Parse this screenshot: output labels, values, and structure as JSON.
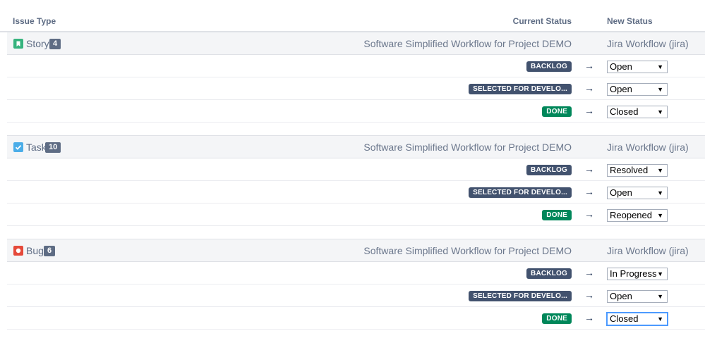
{
  "header": {
    "issue_type": "Issue Type",
    "current_status": "Current Status",
    "new_status": "New Status"
  },
  "groups": [
    {
      "type": "Story",
      "icon": "story-icon",
      "icon_color": "#36b37e",
      "count": "4",
      "current_workflow": "Software Simplified Workflow for Project DEMO",
      "new_workflow": "Jira Workflow (jira)",
      "rows": [
        {
          "status": "BACKLOG",
          "status_color": "#42526e",
          "new_status": "Open"
        },
        {
          "status": "SELECTED FOR DEVELO...",
          "status_color": "#42526e",
          "new_status": "Open"
        },
        {
          "status": "DONE",
          "status_color": "#00875a",
          "new_status": "Closed"
        }
      ]
    },
    {
      "type": "Task",
      "icon": "task-icon",
      "icon_color": "#4bade8",
      "count": "10",
      "current_workflow": "Software Simplified Workflow for Project DEMO",
      "new_workflow": "Jira Workflow (jira)",
      "rows": [
        {
          "status": "BACKLOG",
          "status_color": "#42526e",
          "new_status": "Resolved"
        },
        {
          "status": "SELECTED FOR DEVELO...",
          "status_color": "#42526e",
          "new_status": "Open"
        },
        {
          "status": "DONE",
          "status_color": "#00875a",
          "new_status": "Reopened"
        }
      ]
    },
    {
      "type": "Bug",
      "icon": "bug-icon",
      "icon_color": "#e5493a",
      "count": "6",
      "current_workflow": "Software Simplified Workflow for Project DEMO",
      "new_workflow": "Jira Workflow (jira)",
      "rows": [
        {
          "status": "BACKLOG",
          "status_color": "#42526e",
          "new_status": "In Progress"
        },
        {
          "status": "SELECTED FOR DEVELO...",
          "status_color": "#42526e",
          "new_status": "Open"
        },
        {
          "status": "DONE",
          "status_color": "#00875a",
          "new_status": "Closed"
        }
      ]
    }
  ],
  "arrow": "→",
  "caret": "▼"
}
